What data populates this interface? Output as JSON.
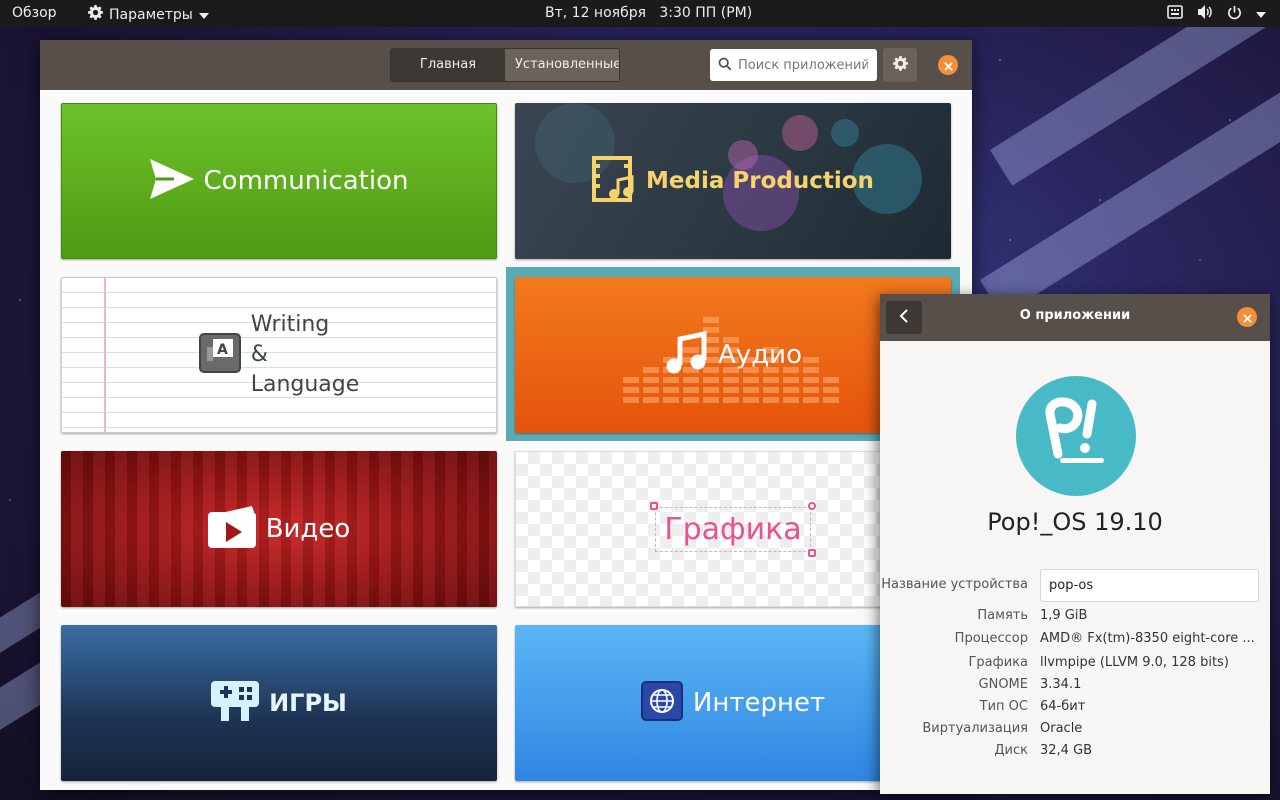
{
  "topbar": {
    "overview": "Обзор",
    "app_menu": "Параметры",
    "clock": "Вт, 12 ноября   3:30 ПП (PM)"
  },
  "software": {
    "tabs": [
      {
        "label": "Главная",
        "active": true
      },
      {
        "label": "Установленные",
        "active": false
      }
    ],
    "search_placeholder": "Поиск приложений",
    "categories": [
      {
        "label": "Communication",
        "icon": "send-icon"
      },
      {
        "label": "Media Production",
        "icon": "film-music-icon"
      },
      {
        "label_lines": [
          "Writing",
          "&",
          "Language"
        ],
        "icon": "text-editor-icon"
      },
      {
        "label": "Аудио",
        "icon": "music-note-icon"
      },
      {
        "label": "Видео",
        "icon": "video-icon"
      },
      {
        "label": "Графика",
        "icon": "selection-frame-icon"
      },
      {
        "label": "ИГРЫ",
        "icon": "gamepad-icon"
      },
      {
        "label": "Интернет",
        "icon": "globe-icon"
      }
    ]
  },
  "about": {
    "title": "О приложении",
    "os_name": "Pop!_OS 19.10",
    "device_name_label": "Название устройства",
    "device_name_value": "pop-os",
    "rows": [
      {
        "key": "Память",
        "value": "1,9 GiB"
      },
      {
        "key": "Процессор",
        "value": "AMD® Fx(tm)-8350 eight-core ..."
      },
      {
        "key": "Графика",
        "value": "llvmpipe (LLVM 9.0, 128 bits)"
      },
      {
        "key": "GNOME",
        "value": "3.34.1"
      },
      {
        "key": "Тип ОС",
        "value": "64-бит"
      },
      {
        "key": "Виртуализация",
        "value": "Oracle"
      },
      {
        "key": "Диск",
        "value": "32,4 GB"
      }
    ]
  },
  "colors": {
    "accent_orange": "#f28f38",
    "header_brown": "#574f4a",
    "pop_teal": "#48b9c7"
  }
}
